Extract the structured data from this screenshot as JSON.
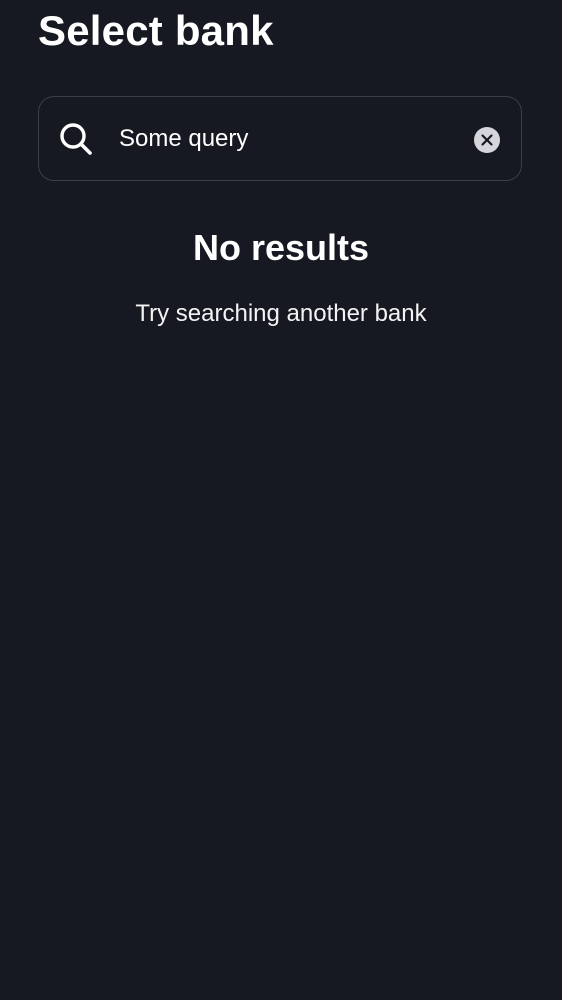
{
  "header": {
    "title": "Select bank"
  },
  "search": {
    "value": "Some query",
    "icon": "search-icon",
    "clear_icon": "clear-circle-icon"
  },
  "empty_state": {
    "title": "No results",
    "subtitle": "Try searching another bank"
  },
  "colors": {
    "background": "#161921",
    "border": "#3a3e48",
    "text": "#ffffff",
    "clear_icon_fill": "#d4d6dc"
  }
}
